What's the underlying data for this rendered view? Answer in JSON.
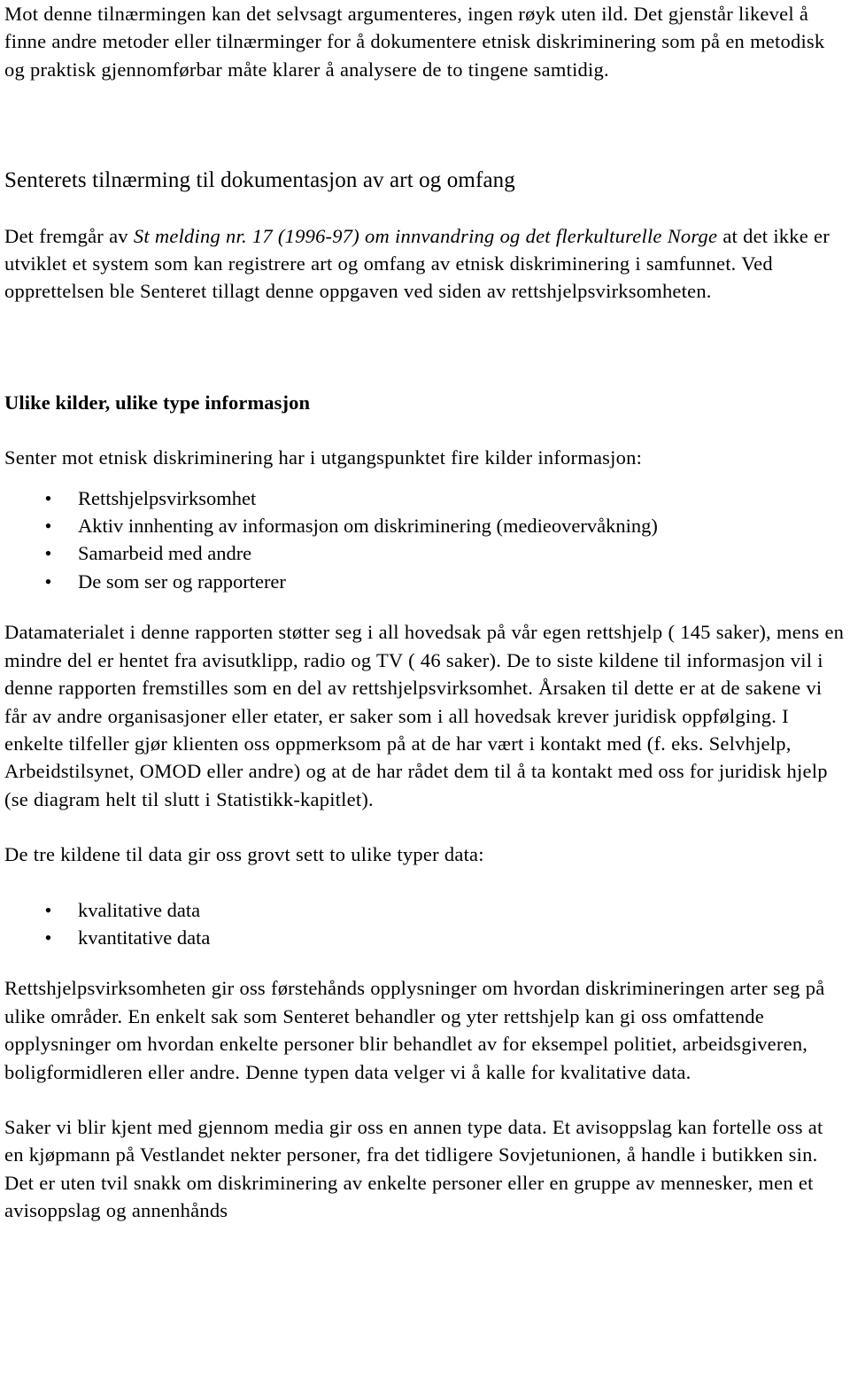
{
  "document": {
    "language": "no",
    "background_color": "#ffffff",
    "text_color": "#000000"
  },
  "blocks": {
    "intro_paragraph": "Mot denne tilnærmingen kan det selvsagt argumenteres, ingen røyk uten ild. Det gjenstår likevel å finne andre metoder eller tilnærminger for å dokumentere etnisk diskriminering som på en metodisk og praktisk gjennomførbar måte klarer å analysere de to tingene samtidig.",
    "section_heading": "Senterets tilnærming til dokumentasjon av art og omfang",
    "stmelding_lead": "Det fremgår av ",
    "stmelding_italic": "St melding nr. 17 (1996-97) om innvandring og det flerkulturelle Norge",
    "stmelding_tail": " at det ikke er utviklet et system som kan registrere art og omfang av etnisk diskriminering i samfunnet. Ved opprettelsen ble Senteret tillagt denne oppgaven ved siden av rettshjelpsvirksomheten.",
    "sub_heading": "Ulike kilder, ulike type informasjon",
    "sources_lead": "Senter mot etnisk diskriminering har i utgangspunktet fire kilder informasjon:",
    "sources_list": [
      "Rettshjelpsvirksomhet",
      "Aktiv innhenting av informasjon om diskriminering (medieovervåkning)",
      "Samarbeid med andre",
      "De som ser og rapporterer"
    ],
    "data_material_paragraph": "Datamaterialet i denne rapporten støtter seg i all hovedsak på vår egen rettshjelp ( 145 saker), mens en mindre del er hentet fra avisutklipp, radio og TV ( 46 saker). De to siste kildene til informasjon vil i denne rapporten fremstilles som en del av rettshjelpsvirksomhet. Årsaken til dette er at de sakene vi får av andre organisasjoner eller etater, er saker som i all hovedsak krever juridisk oppfølging. I enkelte tilfeller gjør klienten oss oppmerksom på at de har vært i kontakt med (f. eks. Selvhjelp, Arbeidstilsynet, OMOD eller andre) og at de har rådet dem til å ta kontakt med oss for juridisk hjelp (se diagram helt til slutt i Statistikk-kapitlet).",
    "data_types_lead": "De tre kildene til data gir oss grovt sett to ulike typer data:",
    "data_types_list": [
      "kvalitative data",
      "kvantitative data"
    ],
    "qualitative_paragraph": "Rettshjelpsvirksomheten gir oss førstehånds opplysninger om hvordan diskrimineringen arter seg på ulike områder. En enkelt sak som Senteret behandler og yter rettshjelp kan gi oss omfattende opplysninger om hvordan enkelte personer blir behandlet av for eksempel politiet, arbeidsgiveren, boligformidleren eller andre. Denne typen data velger vi å kalle for kvalitative data.",
    "media_paragraph": "Saker vi blir kjent med gjennom media gir oss en annen type data. Et avisoppslag kan fortelle oss at en kjøpmann på Vestlandet nekter personer, fra det tidligere Sovjetunionen, å handle i butikken sin. Det er uten tvil snakk om diskriminering av enkelte personer eller en gruppe av mennesker, men et avisoppslag og annenhånds"
  },
  "bullet_glyph": "•"
}
